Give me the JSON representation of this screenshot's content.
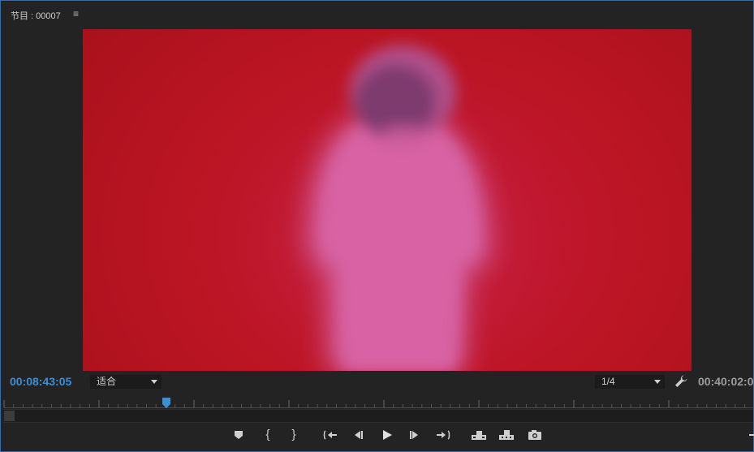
{
  "panel": {
    "title": "节目 : 00007",
    "menu_glyph": "≡"
  },
  "timecode": {
    "current": "00:08:43:05",
    "duration": "00:40:02:0"
  },
  "zoom": {
    "selected": "适合"
  },
  "resolution": {
    "selected": "1/4"
  },
  "playback_progress": 0.217,
  "colors": {
    "accent": "#3a8fd6",
    "frame_background": "#bb1523",
    "panel_border": "#3d6a9a"
  },
  "controls": {
    "mark_in": "{",
    "mark_out": "}",
    "icons": [
      "add-marker-icon",
      "mark-in-icon",
      "mark-out-icon",
      "go-to-in-icon",
      "step-back-icon",
      "play-icon",
      "step-forward-icon",
      "go-to-out-icon",
      "lift-icon",
      "extract-icon",
      "export-frame-icon"
    ]
  }
}
